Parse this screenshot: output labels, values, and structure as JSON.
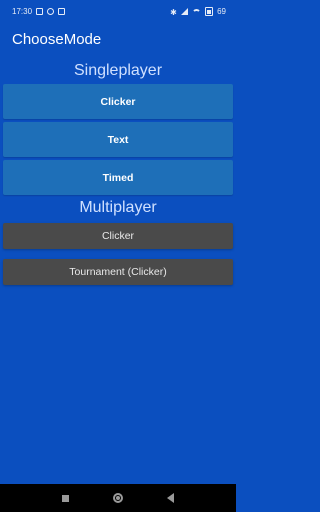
{
  "status_bar": {
    "time": "17:30",
    "battery": "69"
  },
  "app": {
    "title": "ChooseMode"
  },
  "singleplayer": {
    "heading": "Singleplayer",
    "buttons": [
      "Clicker",
      "Text",
      "Timed"
    ]
  },
  "multiplayer": {
    "heading": "Multiplayer",
    "buttons": [
      "Clicker",
      "Tournament (Clicker)"
    ]
  },
  "colors": {
    "background": "#0b4fbf",
    "singleplayer_button": "#1e6fb8",
    "multiplayer_button": "#4a4a4a",
    "nav_bar": "#000000"
  },
  "icons": {
    "status_left": [
      "notification-box-icon",
      "notification-circle-icon",
      "notification-square-icon"
    ],
    "status_right": [
      "bluetooth-icon",
      "signal-icon",
      "wifi-icon",
      "battery-icon"
    ],
    "nav": [
      "recents-icon",
      "home-icon",
      "back-icon"
    ]
  }
}
